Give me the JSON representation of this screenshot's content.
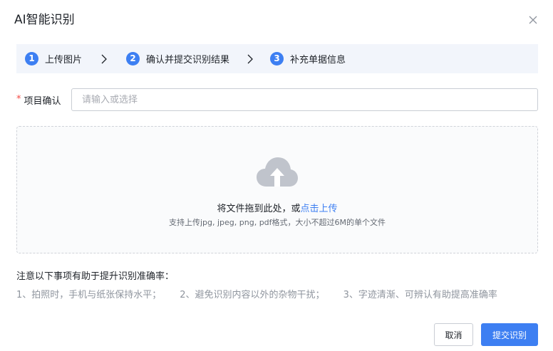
{
  "dialog": {
    "title": "AI智能识别"
  },
  "steps": [
    {
      "num": "1",
      "label": "上传图片"
    },
    {
      "num": "2",
      "label": "确认并提交识别结果"
    },
    {
      "num": "3",
      "label": "补充单据信息"
    }
  ],
  "form": {
    "required_mark": "*",
    "project_label": "项目确认",
    "project_placeholder": "请输入或选择",
    "project_value": ""
  },
  "upload": {
    "drag_text": "将文件拖到此处，或",
    "click_text": "点击上传",
    "hint": "支持上传jpg, jpeg, png, pdf格式，大小不超过6M的单个文件"
  },
  "notes": {
    "title": "注意以下事项有助于提升识别准确率：",
    "items": [
      "1、拍照时，手机与纸张保持水平；",
      "2、避免识别内容以外的杂物干扰；",
      "3、字迹清渐、可辨认有助提高准确率"
    ]
  },
  "buttons": {
    "cancel": "取消",
    "submit": "提交识别"
  },
  "colors": {
    "accent": "#3d7ff2",
    "required": "#f54a45",
    "step_bg": "#f2f5fb",
    "icon_gray": "#c0c4cc"
  },
  "icons": {
    "close": "close-icon",
    "step_arrow": "chevron-right-icon",
    "upload": "cloud-upload-icon"
  }
}
